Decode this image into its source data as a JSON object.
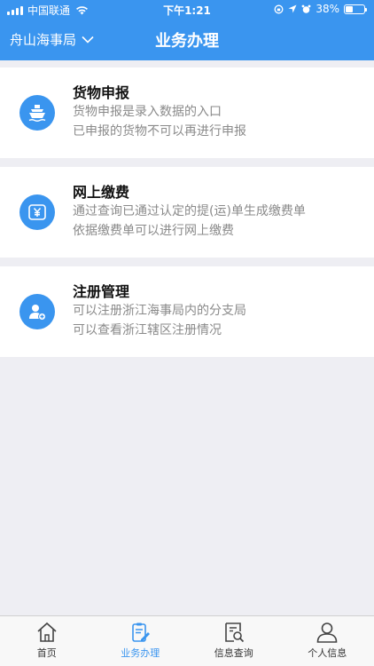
{
  "status_bar": {
    "carrier": "中国联通",
    "time": "下午1:21",
    "battery_percent": "38%",
    "battery_level": 0.38
  },
  "nav": {
    "location": "舟山海事局",
    "title": "业务办理"
  },
  "services": [
    {
      "title": "货物申报",
      "desc_line1": "货物申报是录入数据的入口",
      "desc_line2": "已申报的货物不可以再进行申报",
      "icon": "ship-icon"
    },
    {
      "title": "网上缴费",
      "desc_line1": "通过查询已通过认定的提(运)单生成缴费单",
      "desc_line2": "依据缴费单可以进行网上缴费",
      "icon": "yuan-icon"
    },
    {
      "title": "注册管理",
      "desc_line1": "可以注册浙江海事局内的分支局",
      "desc_line2": "可以查看浙江辖区注册情况",
      "icon": "user-add-icon"
    }
  ],
  "tabs": [
    {
      "label": "首页",
      "icon": "home-icon"
    },
    {
      "label": "业务办理",
      "icon": "clipboard-edit-icon",
      "active": true
    },
    {
      "label": "信息查询",
      "icon": "document-search-icon"
    },
    {
      "label": "个人信息",
      "icon": "person-icon"
    }
  ],
  "colors": {
    "accent": "#3a95ef",
    "background": "#eeeef3",
    "desc_text": "#8a8a8a"
  }
}
